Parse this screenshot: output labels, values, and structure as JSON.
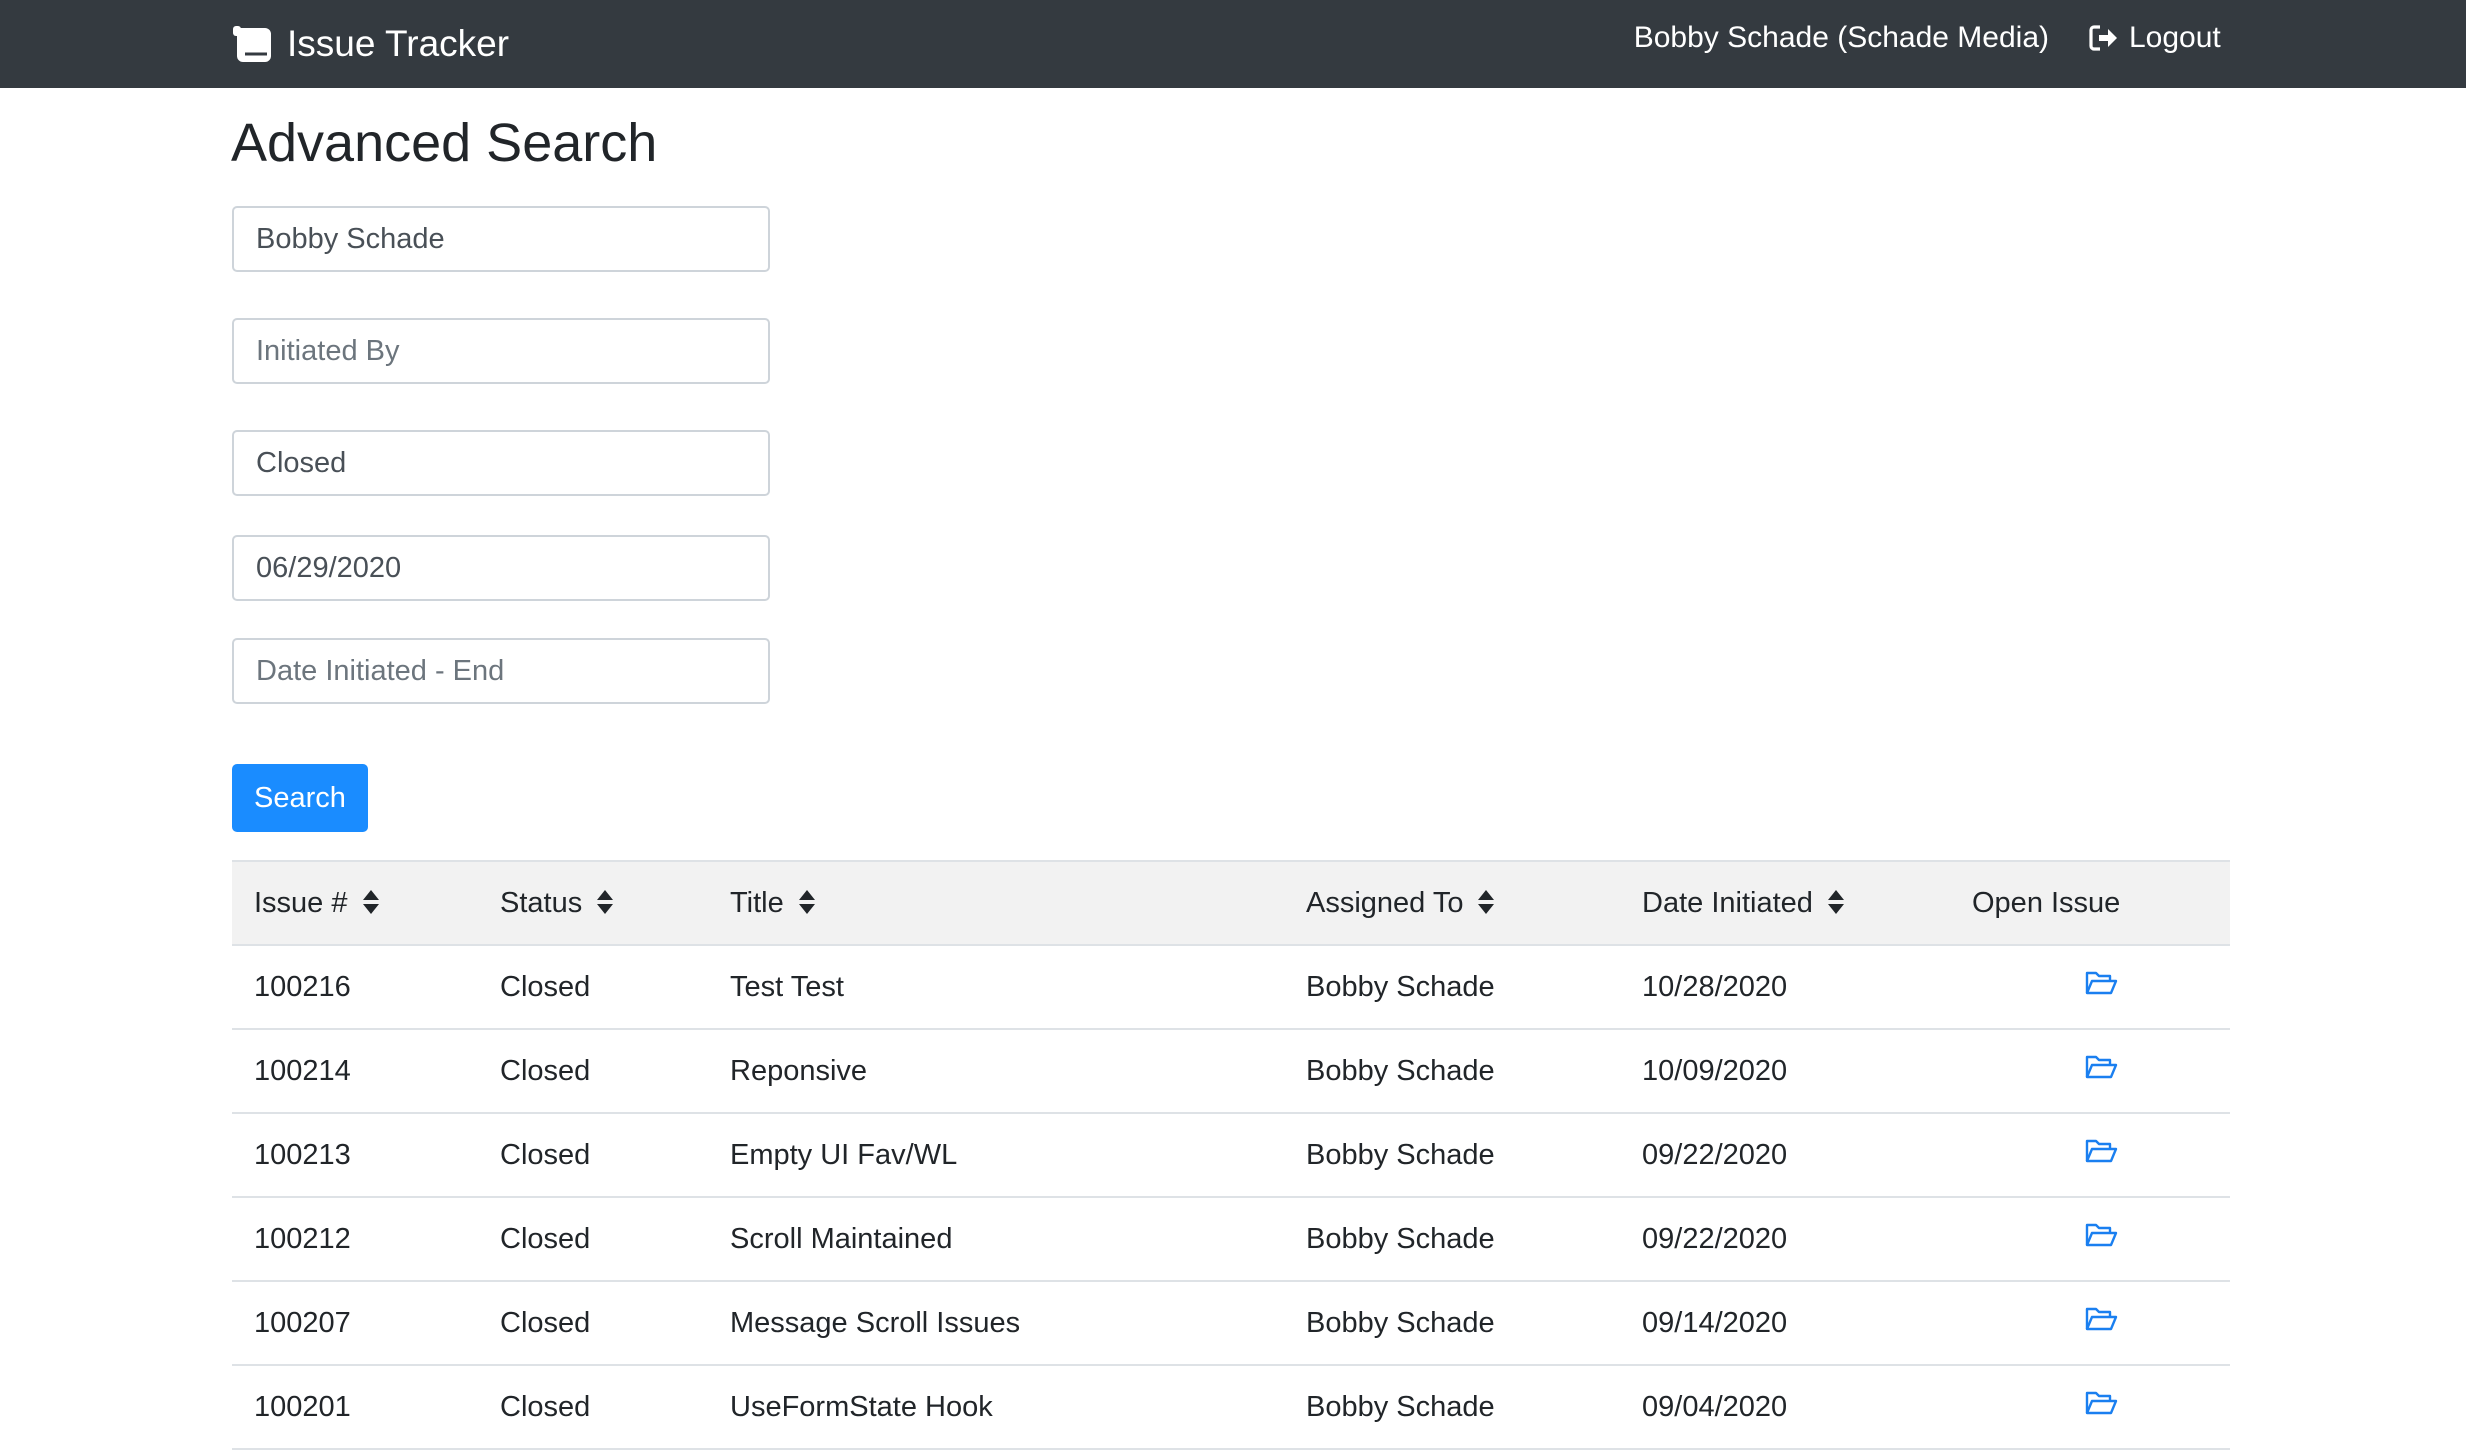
{
  "navbar": {
    "brand": "Issue Tracker",
    "user": "Bobby Schade (Schade Media)",
    "logout_label": "Logout"
  },
  "page": {
    "title": "Advanced Search"
  },
  "search_form": {
    "assigned_to_value": "Bobby Schade",
    "initiated_by_value": "",
    "initiated_by_placeholder": "Initiated By",
    "status_value": "Closed",
    "date_start_value": "06/29/2020",
    "date_end_value": "",
    "date_end_placeholder": "Date Initiated - End",
    "search_label": "Search"
  },
  "table": {
    "headers": [
      "Issue #",
      "Status",
      "Title",
      "Assigned To",
      "Date Initiated",
      "Open Issue"
    ],
    "rows": [
      {
        "id": "100216",
        "status": "Closed",
        "title": "Test Test",
        "assigned": "Bobby Schade",
        "date": "10/28/2020"
      },
      {
        "id": "100214",
        "status": "Closed",
        "title": "Reponsive",
        "assigned": "Bobby Schade",
        "date": "10/09/2020"
      },
      {
        "id": "100213",
        "status": "Closed",
        "title": "Empty UI Fav/WL",
        "assigned": "Bobby Schade",
        "date": "09/22/2020"
      },
      {
        "id": "100212",
        "status": "Closed",
        "title": "Scroll Maintained",
        "assigned": "Bobby Schade",
        "date": "09/22/2020"
      },
      {
        "id": "100207",
        "status": "Closed",
        "title": "Message Scroll Issues",
        "assigned": "Bobby Schade",
        "date": "09/14/2020"
      },
      {
        "id": "100201",
        "status": "Closed",
        "title": "UseFormState Hook",
        "assigned": "Bobby Schade",
        "date": "09/04/2020"
      }
    ]
  },
  "colors": {
    "navbar": "#343a40",
    "primary": "#1a8cff",
    "link_icon": "#1a7ff0",
    "table_header_bg": "#f2f2f2"
  },
  "icons": {
    "brand": "scroll-icon",
    "logout": "sign-out-icon",
    "sort": "sort-icon",
    "open": "folder-open-icon"
  }
}
